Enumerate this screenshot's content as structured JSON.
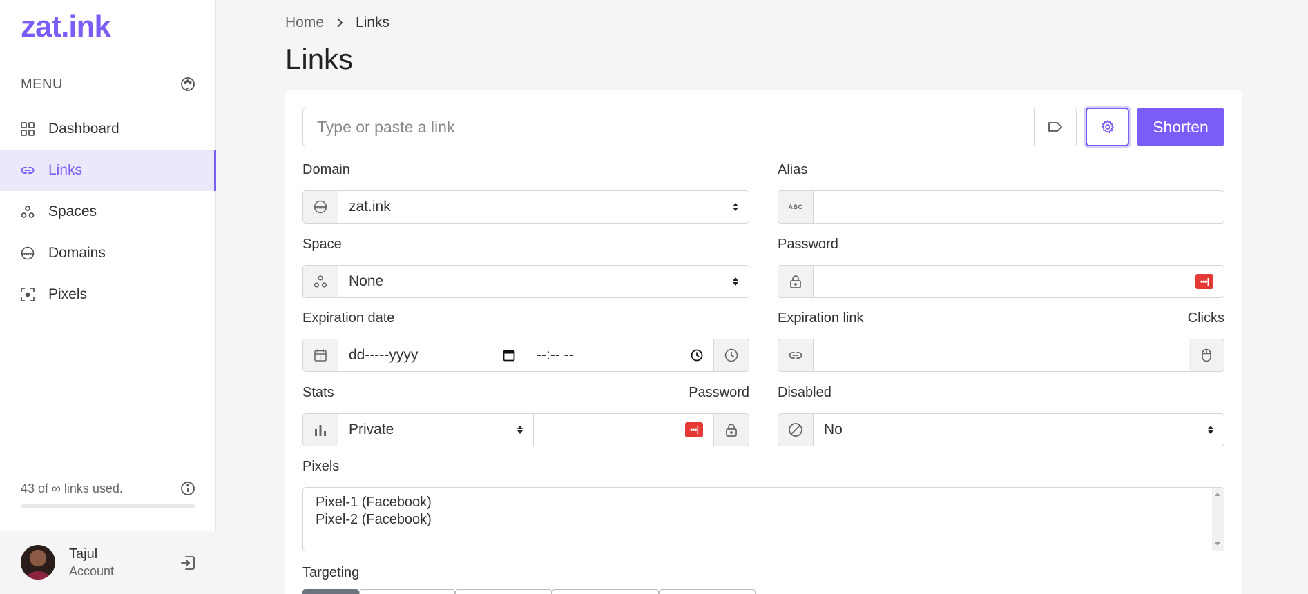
{
  "brand": {
    "logo": "zat.ink",
    "accent": "#7c5cf6"
  },
  "sidebar": {
    "menu_label": "MENU",
    "items": [
      {
        "label": "Dashboard",
        "icon": "grid-icon",
        "active": false
      },
      {
        "label": "Links",
        "icon": "link-icon",
        "active": true
      },
      {
        "label": "Spaces",
        "icon": "spaces-icon",
        "active": false
      },
      {
        "label": "Domains",
        "icon": "www-globe-icon",
        "active": false
      },
      {
        "label": "Pixels",
        "icon": "pixel-icon",
        "active": false
      }
    ],
    "usage_text": "43 of ∞ links used.",
    "user": {
      "name": "Tajul",
      "subtitle": "Account"
    }
  },
  "breadcrumb": {
    "home": "Home",
    "current": "Links"
  },
  "page_title": "Links",
  "form": {
    "url_placeholder": "Type or paste a link",
    "shorten_label": "Shorten",
    "domain": {
      "label": "Domain",
      "value": "zat.ink"
    },
    "alias": {
      "label": "Alias",
      "value": "",
      "icon_text": "ABC"
    },
    "space": {
      "label": "Space",
      "value": "None"
    },
    "password": {
      "label": "Password",
      "value": ""
    },
    "expiration_date": {
      "label": "Expiration date",
      "date_placeholder": "dd-----yyyy",
      "time_placeholder": "--:-- --"
    },
    "expiration_link": {
      "label": "Expiration link",
      "clicks_label": "Clicks"
    },
    "stats": {
      "label": "Stats",
      "value": "Private",
      "password_label": "Password"
    },
    "disabled": {
      "label": "Disabled",
      "value": "No"
    },
    "pixels": {
      "label": "Pixels",
      "options": [
        "Pixel-1 (Facebook)",
        "Pixel-2 (Facebook)"
      ]
    },
    "targeting_label": "Targeting"
  }
}
